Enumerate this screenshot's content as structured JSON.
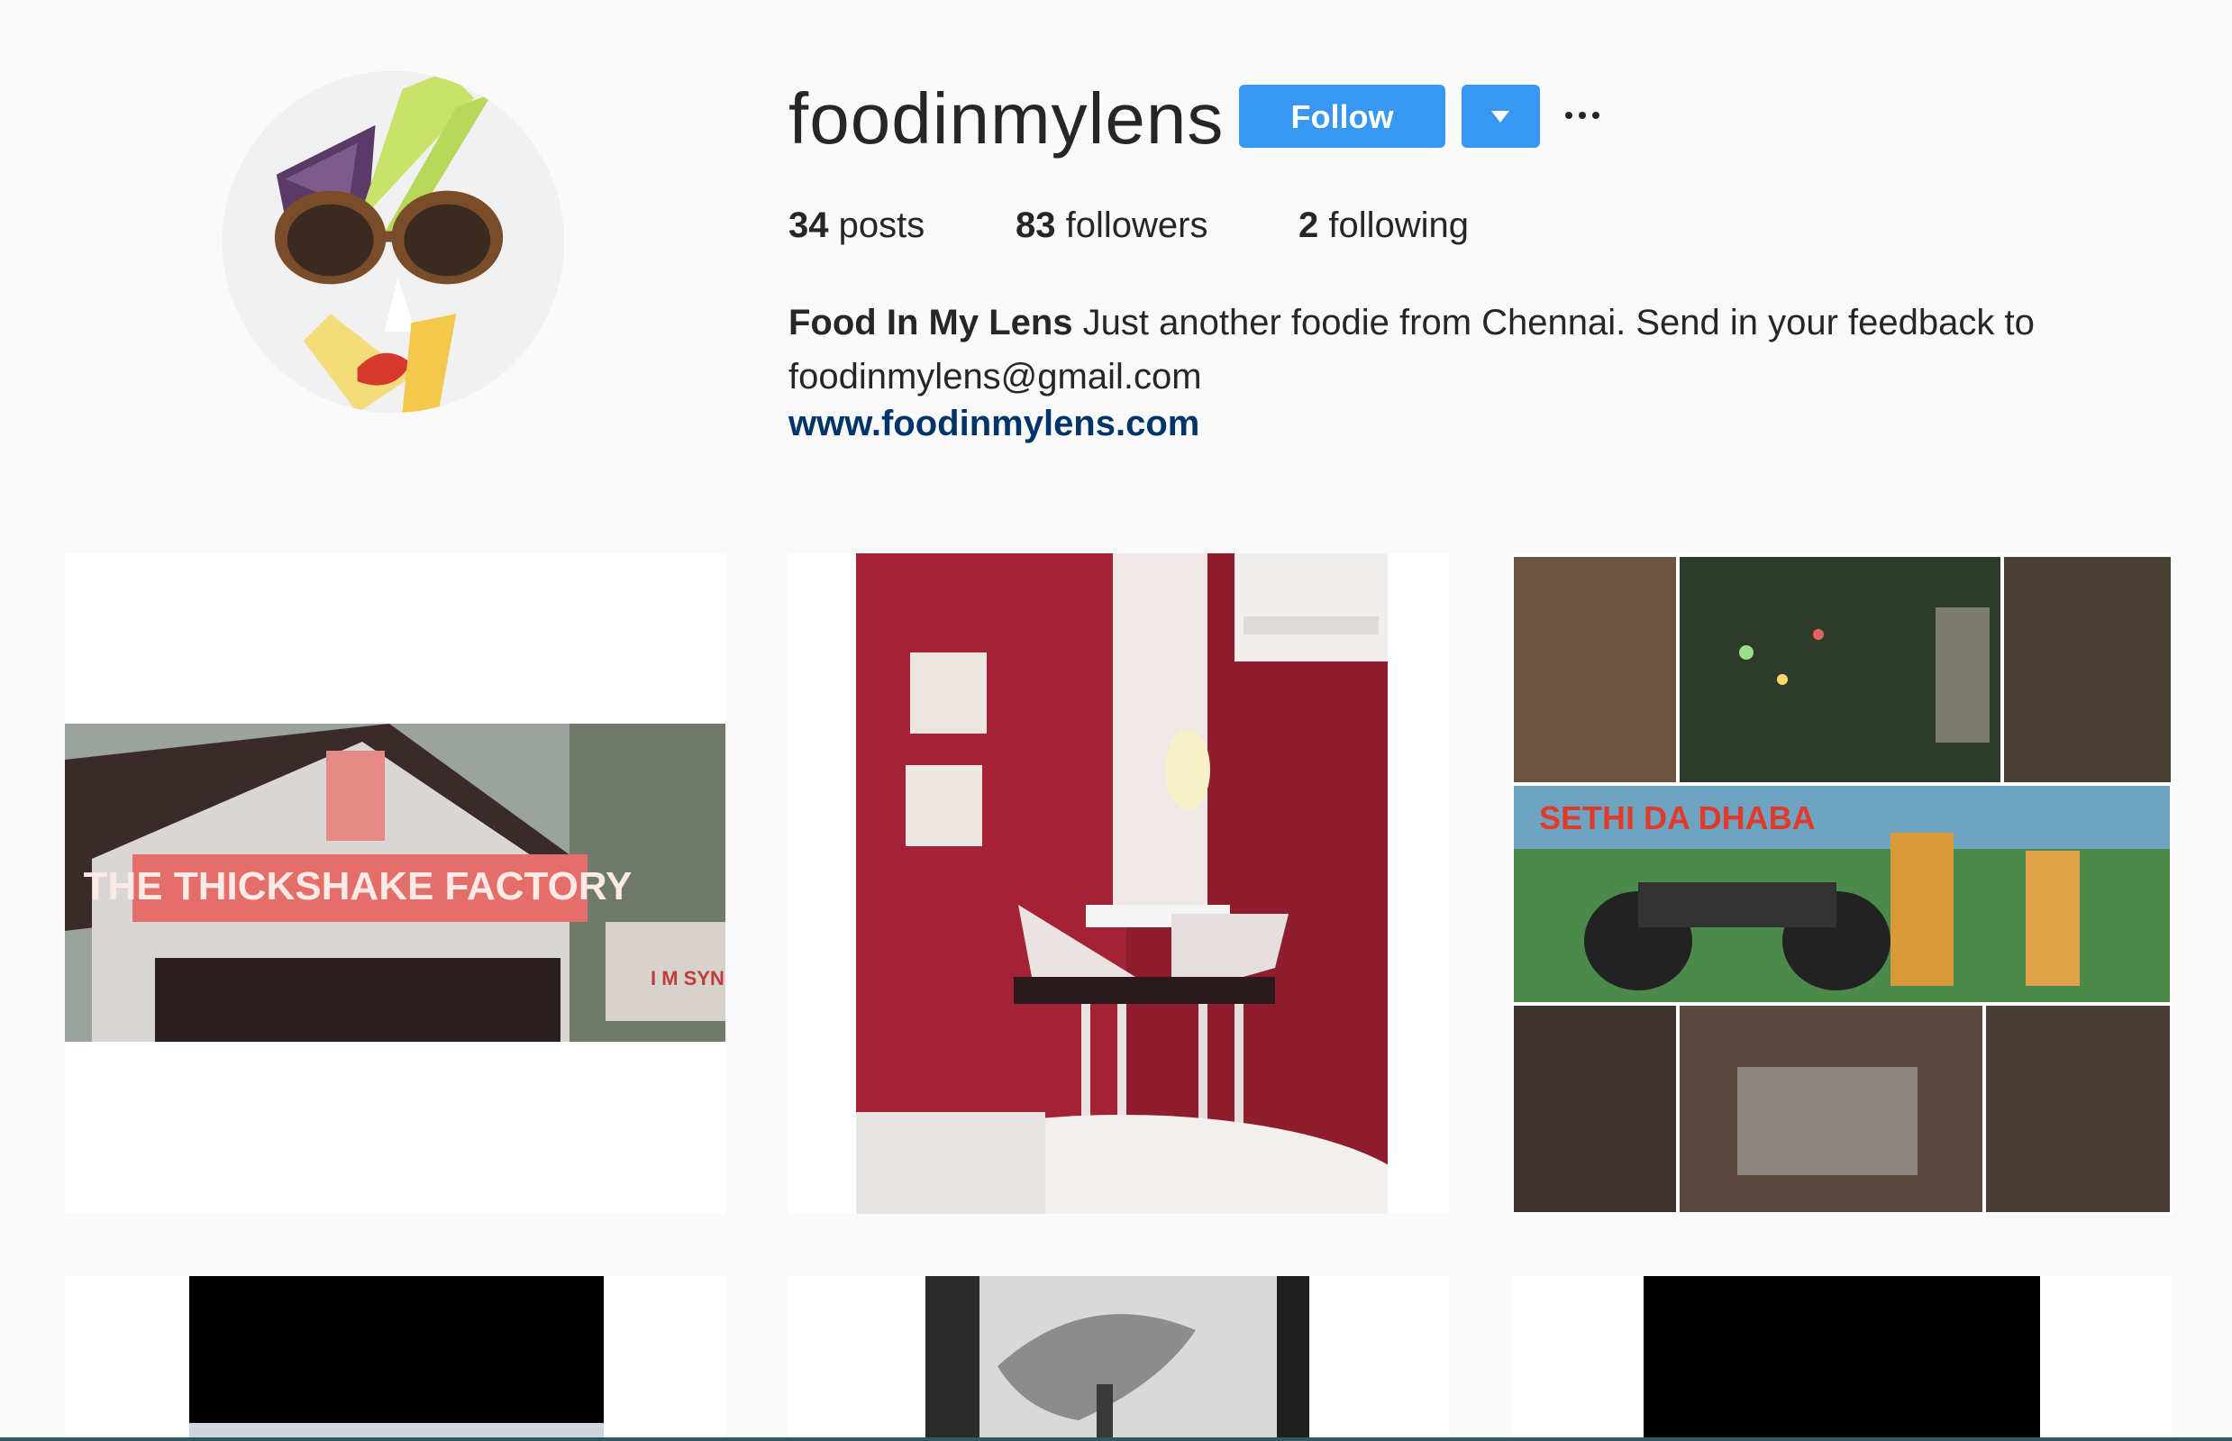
{
  "profile": {
    "username": "foodinmylens",
    "avatar_icon": "avatar-art-icon",
    "follow_label": "Follow",
    "dropdown_icon": "caret-down-icon",
    "more_icon": "ellipsis-icon"
  },
  "stats": {
    "posts_count": "34",
    "posts_label": " posts",
    "followers_count": "83",
    "followers_label": " followers",
    "following_count": "2",
    "following_label": " following"
  },
  "bio": {
    "name": "Food In My Lens",
    "text": " Just another foodie from Chennai. Send in your feedback to foodinmylens@gmail.com",
    "link": "www.foodinmylens.com"
  },
  "posts": [
    {
      "sign_text": "THE THICKSHAKE FACTORY",
      "side_text": "I M SYN"
    },
    {
      "sign_text": ""
    },
    {
      "sign_text": "SETHI DA DHABA"
    },
    {
      "sign_text": ""
    },
    {
      "sign_text": ""
    },
    {
      "sign_text": ""
    }
  ],
  "colors": {
    "accent": "#3897f0",
    "link": "#003569",
    "background": "#fafafa",
    "text": "#262626"
  }
}
